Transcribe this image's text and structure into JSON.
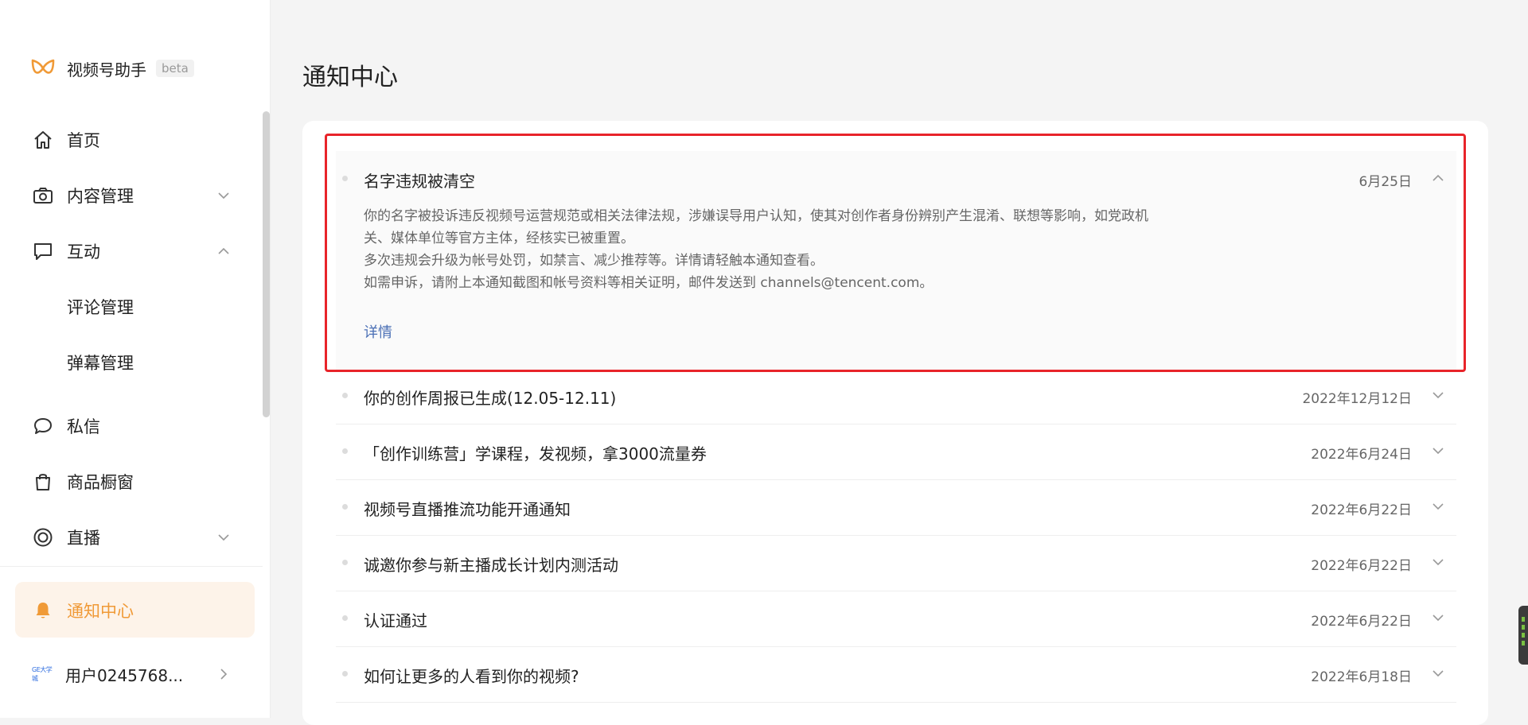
{
  "brand": {
    "name": "视频号助手",
    "badge": "beta",
    "accent": "#f09a37"
  },
  "sidebar": {
    "items": [
      {
        "label": "首页",
        "icon": "home-icon"
      },
      {
        "label": "内容管理",
        "icon": "camera-icon",
        "expanded": false
      },
      {
        "label": "互动",
        "icon": "message-square-icon",
        "expanded": true
      },
      {
        "label": "评论管理",
        "sub": true
      },
      {
        "label": "弹幕管理",
        "sub": true
      },
      {
        "label": "私信",
        "icon": "chat-bubble-icon"
      },
      {
        "label": "商品橱窗",
        "icon": "shopping-bag-icon"
      },
      {
        "label": "直播",
        "icon": "live-circle-icon",
        "expanded": false
      },
      {
        "label": "通知中心",
        "icon": "bell-icon",
        "active": true
      }
    ],
    "user": {
      "name": "用户0245768...",
      "avatar_text": "GE大学城"
    }
  },
  "main": {
    "title": "通知中心",
    "notifications": [
      {
        "title": "名字违规被清空",
        "date": "6月25日",
        "expanded": true,
        "body": [
          "你的名字被投诉违反视频号运营规范或相关法律法规，涉嫌误导用户认知，使其对创作者身份辨别产生混淆、联想等影响，如党政机",
          "关、媒体单位等官方主体，经核实已被重置。",
          "多次违规会升级为帐号处罚，如禁言、减少推荐等。详情请轻触本通知查看。",
          "如需申诉，请附上本通知截图和帐号资料等相关证明，邮件发送到 channels@tencent.com。"
        ],
        "link": "详情"
      },
      {
        "title": "你的创作周报已生成(12.05-12.11)",
        "date": "2022年12月12日"
      },
      {
        "title": "「创作训练营」学课程，发视频，拿3000流量券",
        "date": "2022年6月24日"
      },
      {
        "title": "视频号直播推流功能开通通知",
        "date": "2022年6月22日"
      },
      {
        "title": "诚邀你参与新主播成长计划内测活动",
        "date": "2022年6月22日"
      },
      {
        "title": "认证通过",
        "date": "2022年6月22日"
      },
      {
        "title": "如何让更多的人看到你的视频?",
        "date": "2022年6月18日"
      }
    ]
  },
  "colors": {
    "highlight_border": "#e8242a",
    "link": "#4a6fb5",
    "active_bg": "#fdf3e9"
  }
}
